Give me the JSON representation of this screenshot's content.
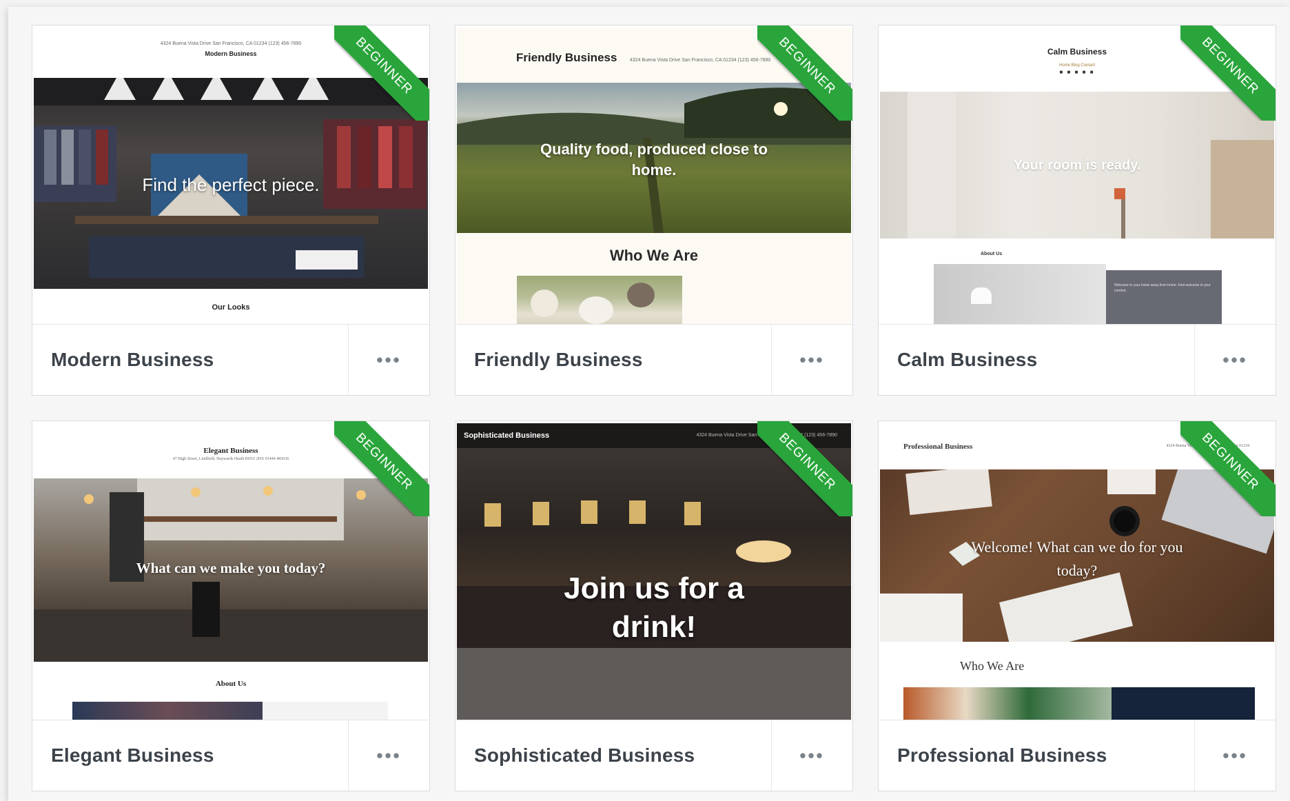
{
  "ribbon_label": "BEGINNER",
  "more_label": "•••",
  "themes": [
    {
      "name": "Modern Business",
      "preview": {
        "address": "4324 Buena Vista Drive San Francisco, CA 01234 (123) 456-7890",
        "site_title": "Modern Business",
        "hero": "Find the perfect piece.",
        "section": "Our Looks"
      }
    },
    {
      "name": "Friendly Business",
      "preview": {
        "site_title": "Friendly Business",
        "address": "4324 Buena Vista Drive San Francisco, CA 01234 (123) 456-7890",
        "hero": "Quality food, produced close to home.",
        "section": "Who We Are"
      }
    },
    {
      "name": "Calm Business",
      "preview": {
        "site_title": "Calm Business",
        "nav": "Home  Blog  Contact",
        "hero": "Your room is ready.",
        "section": "About Us",
        "side_text": "Welcome to your home away from home. Feel welcome in your comfort."
      }
    },
    {
      "name": "Elegant Business",
      "preview": {
        "site_title": "Elegant Business",
        "address": "47 High Street, Lindfield, Haywards Heath RH16 2HX 01444 483636",
        "hero": "What can we make you today?",
        "section": "About Us"
      }
    },
    {
      "name": "Sophisticated Business",
      "preview": {
        "site_title": "Sophisticated Business",
        "address": "4324 Buena Vista Drive San Francisco, CA 01234 (123) 456-7890",
        "hero": "Join us for a drink!"
      }
    },
    {
      "name": "Professional Business",
      "preview": {
        "site_title": "Professional Business",
        "address": "4324 Buena Vista Drive San Francisco, CA 01234",
        "hero": "Welcome! What can we do for you today?",
        "section": "Who We Are"
      }
    }
  ],
  "colors": {
    "ribbon": "#2aa53b",
    "card_title": "#3c434a",
    "more_dots": "#7b838a"
  }
}
